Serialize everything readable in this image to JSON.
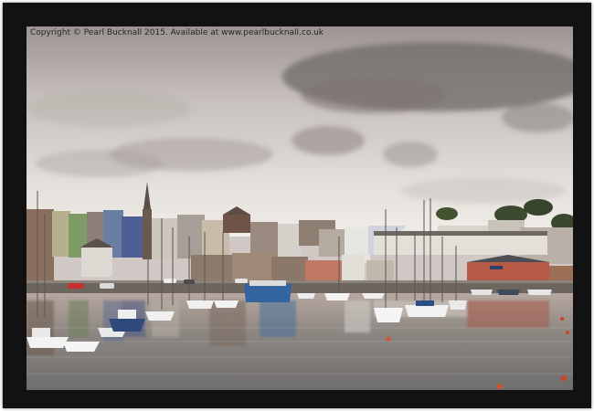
{
  "image": {
    "subject": "harbour-town",
    "copyright": "Copyright © Pearl Bucknall 2015. Available at www.pearlbucknall.co.uk"
  },
  "colors": {
    "frame": "#121212",
    "sky_top": "#a39a97",
    "sky_bottom": "#e6e2dd",
    "water": "#8a8480",
    "harbour_building": "#b65a45"
  }
}
